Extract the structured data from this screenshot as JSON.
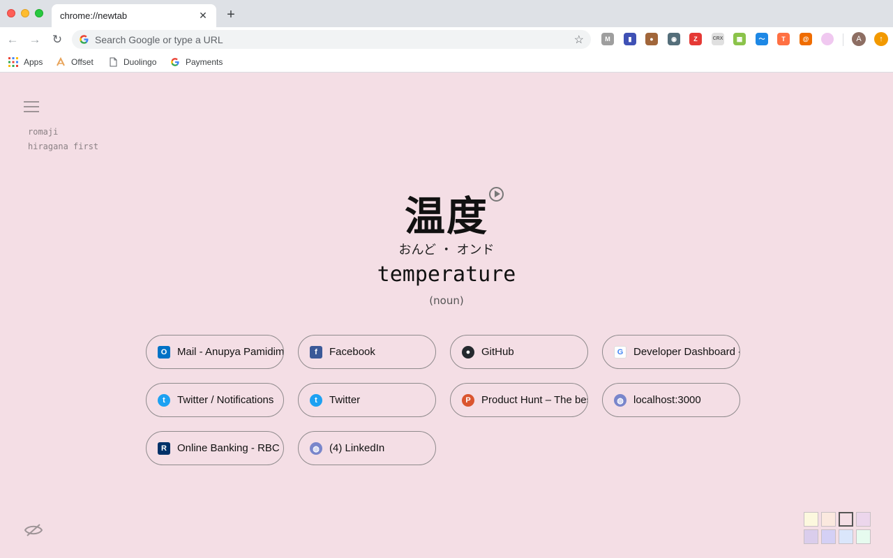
{
  "browser": {
    "tab_title": "chrome://newtab",
    "omnibox_placeholder": "Search Google or type a URL",
    "profile_initial": "A",
    "update_badge": "↑",
    "extensions": [
      {
        "name": "mercury-reader-icon",
        "label": "M",
        "color": "#9e9e9e"
      },
      {
        "name": "charts-extension-icon",
        "label": "▮",
        "color": "#3f51b5"
      },
      {
        "name": "cookie-extension-icon",
        "label": "●",
        "color": "#a1663a"
      },
      {
        "name": "owl-extension-icon",
        "label": "◉",
        "color": "#546e7a"
      },
      {
        "name": "zotero-extension-icon",
        "label": "Z",
        "color": "#e53935"
      },
      {
        "name": "crx-extension-icon",
        "label": "CRX",
        "color": "#bdbdbd"
      },
      {
        "name": "grid-extension-icon",
        "label": "▦",
        "color": "#8bc34a"
      },
      {
        "name": "wave-extension-icon",
        "label": "〜",
        "color": "#1e88e5"
      },
      {
        "name": "colorful-extension-icon",
        "label": "T",
        "color": "#ff7043"
      },
      {
        "name": "spiral-extension-icon",
        "label": "@",
        "color": "#ef6c00"
      },
      {
        "name": "pink-circle-extension-icon",
        "label": "",
        "color": "#f0c8f0"
      }
    ]
  },
  "bookmarks": [
    {
      "name": "bookmark-apps",
      "label": "Apps",
      "icon": "apps-grid-icon"
    },
    {
      "name": "bookmark-offset",
      "label": "Offset",
      "icon": "offset-icon"
    },
    {
      "name": "bookmark-duolingo",
      "label": "Duolingo",
      "icon": "page-icon"
    },
    {
      "name": "bookmark-payments",
      "label": "Payments",
      "icon": "google-icon"
    }
  ],
  "menu": {
    "option1": "romaji",
    "option2": "hiragana first"
  },
  "word": {
    "kanji": "温度",
    "reading": "おんど ・ オンド",
    "meaning": "temperature",
    "part_of_speech": "(noun)"
  },
  "shortcuts": [
    {
      "label": "Mail - Anupya Pamidimukkala",
      "icon": "outlook-icon",
      "color": "#0072c6",
      "glyph": "O"
    },
    {
      "label": "Facebook",
      "icon": "facebook-icon",
      "color": "#3b5998",
      "glyph": "f"
    },
    {
      "label": "GitHub",
      "icon": "github-icon",
      "color": "#24292e",
      "glyph": "●"
    },
    {
      "label": "Developer Dashboard - Chrome",
      "icon": "google-icon",
      "color": "#ffffff",
      "glyph": "G"
    },
    {
      "label": "Twitter / Notifications",
      "icon": "twitter-icon",
      "color": "#1da1f2",
      "glyph": "t"
    },
    {
      "label": "Twitter",
      "icon": "twitter-icon",
      "color": "#1da1f2",
      "glyph": "t"
    },
    {
      "label": "Product Hunt – The best new products",
      "icon": "product-hunt-icon",
      "color": "#da552f",
      "glyph": "P"
    },
    {
      "label": "localhost:3000",
      "icon": "globe-icon",
      "color": "#7986cb",
      "glyph": "◍"
    },
    {
      "label": "Online Banking - RBC Royal Bank",
      "icon": "rbc-icon",
      "color": "#003168",
      "glyph": "R"
    },
    {
      "label": "(4) LinkedIn",
      "icon": "globe-icon",
      "color": "#7986cb",
      "glyph": "◍"
    }
  ],
  "theme_swatches": [
    "#fcf8de",
    "#fbe9df",
    "#f4dee5",
    "#ecd6ec",
    "#dacdec",
    "#d4d0f5",
    "#dae6fb",
    "#e6fbef"
  ],
  "colors": {
    "background": "#f4dee5",
    "selected_swatch": "#f4dee5"
  }
}
